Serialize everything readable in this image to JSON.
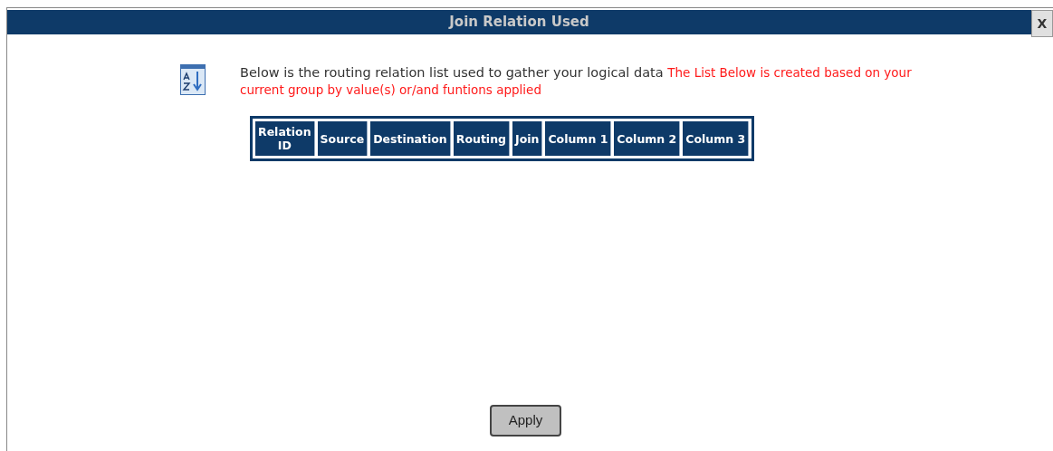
{
  "dialog": {
    "title": "Join Relation Used",
    "close_label": "X"
  },
  "intro": {
    "text": "Below is the routing relation list used to gather your logical data",
    "note": "The List Below is created based on your current group by value(s) or/and funtions applied"
  },
  "table": {
    "columns": [
      "Relation ID",
      "Source",
      "Destination",
      "Routing",
      "Join",
      "Column 1",
      "Column 2",
      "Column 3"
    ]
  },
  "buttons": [
    "Apply"
  ]
}
